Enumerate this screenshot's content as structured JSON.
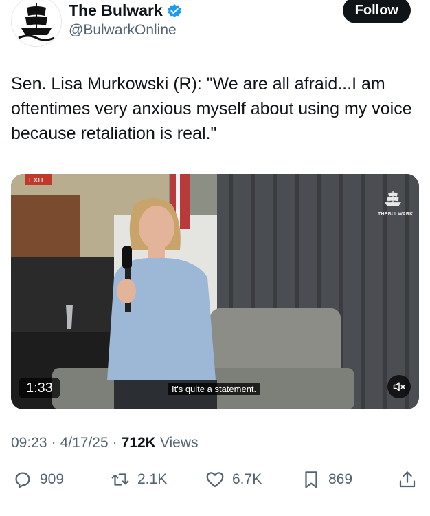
{
  "account": {
    "display_name": "The Bulwark",
    "handle": "@BulwarkOnline",
    "follow_label": "Follow",
    "verified_color": "#1d9bf0"
  },
  "tweet": {
    "text": "Sen. Lisa Murkowski (R): \"We are all afraid...I am oftentimes very anxious myself about using my voice because retaliation is real.\""
  },
  "video": {
    "duration": "1:33",
    "caption": "It's quite a statement.",
    "watermark": "THEBULWARK",
    "exit_sign": "EXIT"
  },
  "meta": {
    "time": "09:23",
    "date": "4/17/25",
    "views_count": "712K",
    "views_label": "Views",
    "separator": "·"
  },
  "actions": {
    "replies": "909",
    "reposts": "2.1K",
    "likes": "6.7K",
    "bookmarks": "869"
  }
}
